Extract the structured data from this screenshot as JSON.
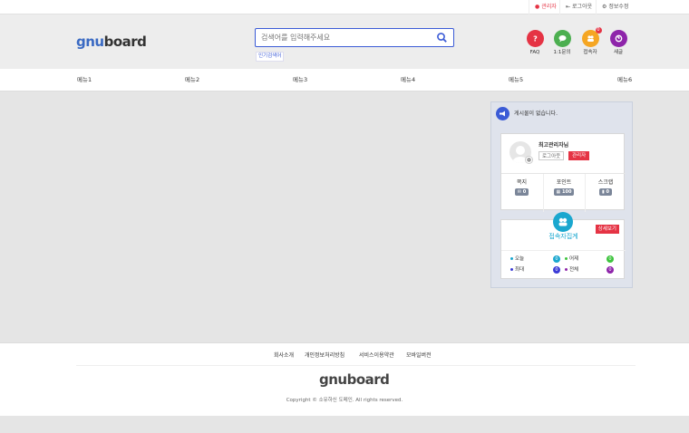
{
  "top_bar": {
    "admin_label": "관리자",
    "logout_label": "로그아웃",
    "edit_info_label": "정보수정"
  },
  "header": {
    "logo_part1": "gnu",
    "logo_part2": "board",
    "search_placeholder": "검색어를 입력해주세요",
    "popular_label": "인기검색어",
    "quick": [
      {
        "label": "FAQ",
        "icon": "question-icon",
        "color": "#e53344"
      },
      {
        "label": "1:1문의",
        "icon": "chat-icon",
        "color": "#4caf50"
      },
      {
        "label": "접속자",
        "icon": "users-icon",
        "color": "#f5a623",
        "badge": "0"
      },
      {
        "label": "새글",
        "icon": "new-post-icon",
        "color": "#8e24aa"
      }
    ]
  },
  "gnb": {
    "items": [
      "메뉴1",
      "메뉴2",
      "메뉴3",
      "메뉴4",
      "메뉴5",
      "메뉴6"
    ]
  },
  "aside": {
    "notice_text": "게시물이 없습니다.",
    "outlogin": {
      "nickname": "최고관리자님",
      "logout_label": "로그아웃",
      "admin_label": "관리자",
      "stats": [
        {
          "label": "쪽지",
          "value": "0",
          "icon": "mail-icon"
        },
        {
          "label": "포인트",
          "value": "100",
          "icon": "point-icon"
        },
        {
          "label": "스크랩",
          "value": "0",
          "icon": "scrap-icon"
        }
      ]
    },
    "visit": {
      "title": "접속자집계",
      "more_label": "상세보기",
      "rows": [
        {
          "label": "오늘",
          "value": "0",
          "color": "#1aa7cf"
        },
        {
          "label": "어제",
          "value": "0",
          "color": "#3ec43e"
        },
        {
          "label": "최대",
          "value": "0",
          "color": "#3b3bd6"
        },
        {
          "label": "전체",
          "value": "0",
          "color": "#8e24aa"
        }
      ]
    }
  },
  "footer": {
    "links": [
      "회사소개",
      "개인정보처리방침",
      "서비스이용약관",
      "모바일버전"
    ],
    "logo_part1": "gnu",
    "logo_part2": "board",
    "copyright": "Copyright © 소유하신 도메인. All rights reserved."
  }
}
